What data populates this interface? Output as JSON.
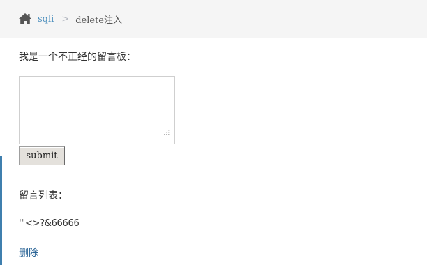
{
  "breadcrumb": {
    "home_icon": "home-icon",
    "link_label": "sqli",
    "separator": ">",
    "current": "delete注入"
  },
  "form": {
    "intro": "我是一个不正经的留言板：",
    "textarea_value": "",
    "submit_label": "submit"
  },
  "messages": {
    "title": "留言列表：",
    "items": [
      {
        "content": "'\"<>?&66666",
        "delete_label": "删除"
      }
    ]
  },
  "colors": {
    "link": "#4c8fbd",
    "delete_link": "#2a6496",
    "breadcrumb_bg": "#f5f5f5",
    "accent_bar": "#3f7fae"
  }
}
